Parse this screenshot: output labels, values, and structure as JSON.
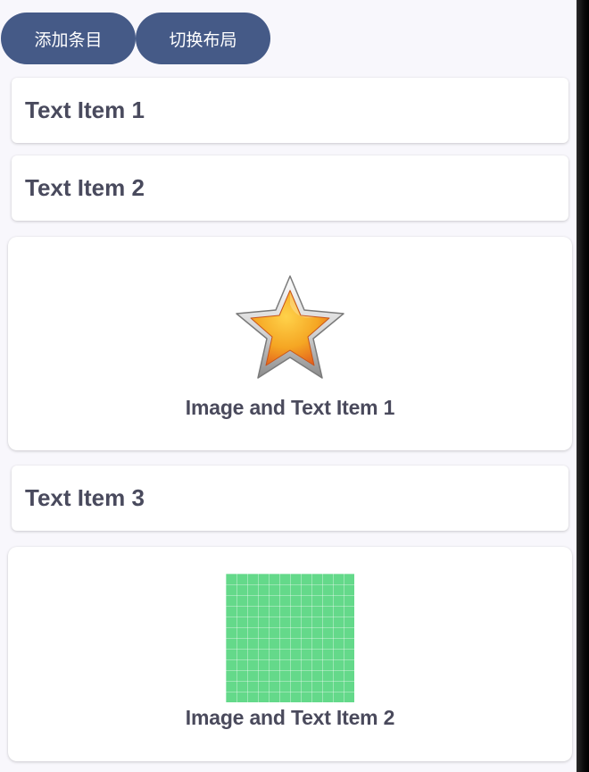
{
  "toolbar": {
    "add_label": "添加条目",
    "toggle_label": "切换布局"
  },
  "items": [
    {
      "type": "text",
      "label": "Text Item 1"
    },
    {
      "type": "text",
      "label": "Text Item 2"
    },
    {
      "type": "image_text",
      "icon": "star-icon",
      "caption": "Image and Text Item 1"
    },
    {
      "type": "text",
      "label": "Text Item 3"
    },
    {
      "type": "image_text",
      "icon": "green-grid-image",
      "caption": "Image and Text Item 2"
    }
  ],
  "colors": {
    "button": "#455a87",
    "background": "#f8f7fc",
    "text": "#494a5d",
    "green_image": "#64d98a"
  }
}
